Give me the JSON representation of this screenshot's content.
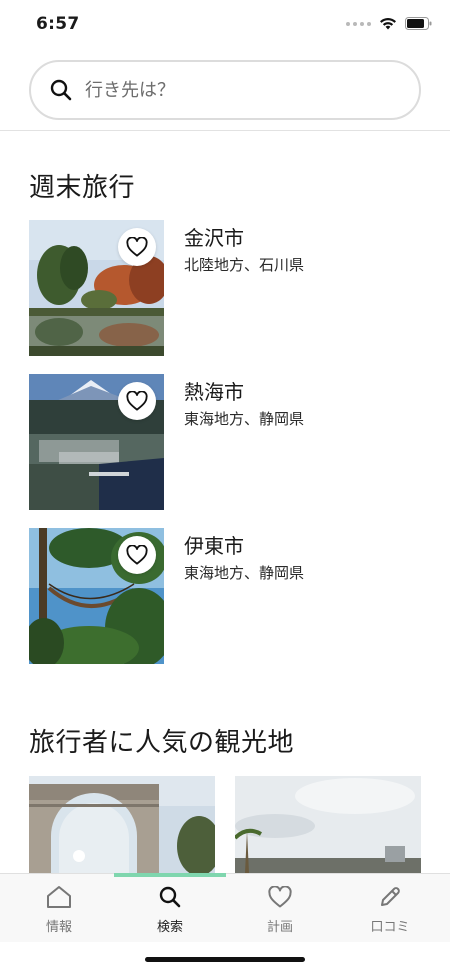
{
  "status_bar": {
    "time": "6:57"
  },
  "search": {
    "placeholder": "行き先は？"
  },
  "weekend": {
    "title": "週末旅行",
    "items": [
      {
        "name": "金沢市",
        "region": "北陸地方、石川県"
      },
      {
        "name": "熱海市",
        "region": "東海地方、静岡県"
      },
      {
        "name": "伊東市",
        "region": "東海地方、静岡県"
      }
    ]
  },
  "popular": {
    "title": "旅行者に人気の観光地"
  },
  "tabs": [
    {
      "label": "情報",
      "icon": "home-icon"
    },
    {
      "label": "検索",
      "icon": "search-icon"
    },
    {
      "label": "計画",
      "icon": "heart-icon"
    },
    {
      "label": "口コミ",
      "icon": "pencil-icon"
    }
  ],
  "colors": {
    "accent": "#7fd6ae",
    "border": "#dcdcdc",
    "tab_bg": "#f8f8f8"
  }
}
